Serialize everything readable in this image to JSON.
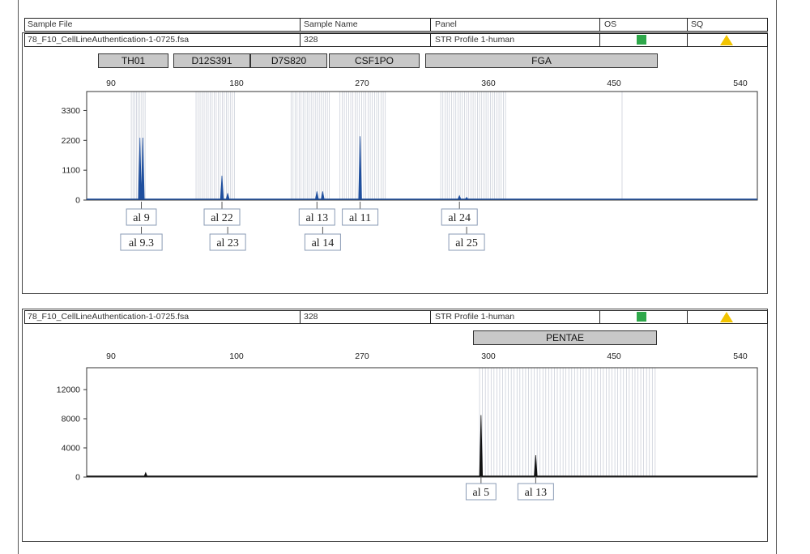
{
  "header": {
    "sample_file_label": "Sample File",
    "sample_name_label": "Sample Name",
    "panel_label": "Panel",
    "os_label": "OS",
    "sq_label": "SQ"
  },
  "rows": [
    {
      "sample_file": "78_F10_CellLineAuthentication-1-0725.fsa",
      "sample_name": "328",
      "panel": "STR Profile 1-human"
    },
    {
      "sample_file": "78_F10_CellLineAuthentication-1-0725.fsa",
      "sample_name": "328",
      "panel": "STR Profile 1-human"
    }
  ],
  "colors": {
    "os_quality": "#2ea84a",
    "sq_quality": "#f2c400",
    "trace_blue": "#1f4f9e",
    "trace_black": "#111111",
    "bin_line": "#c4c9d4"
  },
  "icons": {
    "os": "green-square-icon",
    "sq": "yellow-triangle-icon"
  },
  "chart_data": [
    {
      "type": "line",
      "x_tick_labels": [
        "90",
        "180",
        "270",
        "360",
        "450",
        "540"
      ],
      "y_tick_labels": [
        "3300",
        "2200",
        "1100",
        "0"
      ],
      "xlim": [
        86,
        552
      ],
      "ylim": [
        0,
        4000
      ],
      "markers": [
        "TH01",
        "D12S391",
        "D7S820",
        "CSF1PO",
        "FGA"
      ],
      "peaks": [
        {
          "x": 123,
          "y": 2300
        },
        {
          "x": 125,
          "y": 2300
        },
        {
          "x": 180,
          "y": 900
        },
        {
          "x": 184,
          "y": 250
        },
        {
          "x": 246,
          "y": 320
        },
        {
          "x": 250,
          "y": 320
        },
        {
          "x": 276,
          "y": 2350
        },
        {
          "x": 345,
          "y": 160
        },
        {
          "x": 350,
          "y": 100
        }
      ],
      "allele_labels": [
        {
          "x": 124,
          "row": 1,
          "label": "al 9"
        },
        {
          "x": 124,
          "row": 2,
          "label": "al 9.3"
        },
        {
          "x": 180,
          "row": 1,
          "label": "al 22"
        },
        {
          "x": 184,
          "row": 2,
          "label": "al 23"
        },
        {
          "x": 246,
          "row": 1,
          "label": "al 13"
        },
        {
          "x": 250,
          "row": 2,
          "label": "al 14"
        },
        {
          "x": 276,
          "row": 1,
          "label": "al 11"
        },
        {
          "x": 345,
          "row": 1,
          "label": "al 24"
        },
        {
          "x": 350,
          "row": 2,
          "label": "al 25"
        }
      ]
    },
    {
      "type": "line",
      "x_tick_labels": [
        "90",
        "100",
        "270",
        "300",
        "450",
        "540"
      ],
      "y_tick_labels": [
        "12000",
        "8000",
        "4000",
        "0"
      ],
      "xlim": [
        86,
        552
      ],
      "ylim": [
        0,
        15000
      ],
      "markers": [
        "PENTAE"
      ],
      "peaks": [
        {
          "x": 127,
          "y": 600
        },
        {
          "x": 360,
          "y": 8500
        },
        {
          "x": 398,
          "y": 3000
        }
      ],
      "allele_labels": [
        {
          "x": 360,
          "row": 1,
          "label": "al 5"
        },
        {
          "x": 398,
          "row": 1,
          "label": "al 13"
        }
      ]
    }
  ]
}
